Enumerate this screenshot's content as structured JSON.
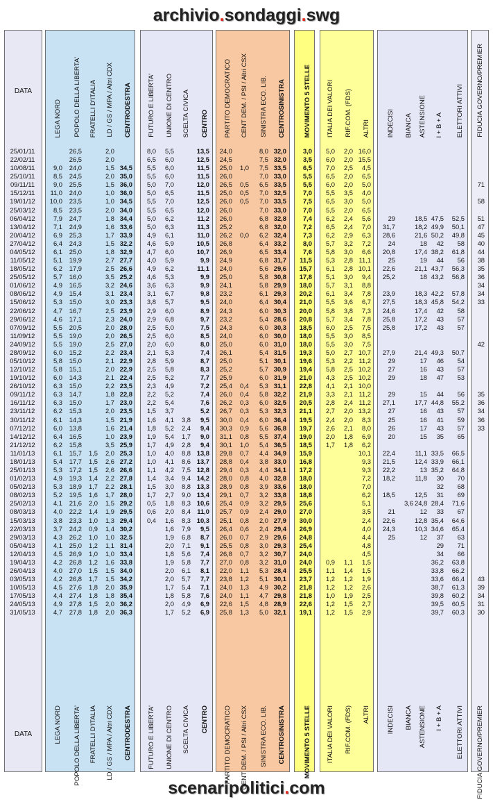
{
  "header_title": {
    "part1": "archivio",
    "dot1": ".",
    "part2": "sondaggi",
    "dot2": ".",
    "part3": "swg"
  },
  "footer_title": {
    "part1": "scenaripolitici",
    "dot": ".",
    "part2": "com"
  },
  "colors": {
    "data_band": "#e8e8f4",
    "centrodestra_band": "#c9e2f3",
    "centro_band": "#e6e7f6",
    "centrosinistra_band": "#f8c8a2",
    "m5s_band": "#ffff80",
    "idv_band": "#ffff9a",
    "astensione_band": "#e6e7f6",
    "fiducia_band": "#ecedf6",
    "accent": "#e0261b"
  },
  "groups": [
    {
      "id": "data",
      "band": "data_band",
      "columns": [
        "DATA"
      ],
      "horizontal": true
    },
    {
      "id": "cdx",
      "band": "centrodestra_band",
      "columns": [
        "LEGA NORD",
        "POPOLO DELLA LIBERTA'",
        "FRATELLI D'ITALIA",
        "LD / GS / MPA / Altri CDX",
        "CENTRODESTRA"
      ]
    },
    {
      "id": "ctr",
      "band": "centro_band",
      "columns": [
        "FUTURO E LIBERTA'",
        "UNIONE DI CENTRO",
        "SCELTA CIVICA",
        "CENTRO"
      ]
    },
    {
      "id": "csx",
      "band": "centrosinistra_band",
      "columns": [
        "PARTITO DEMOCRATICO",
        "CENT DEM. / PSI / Altri CSX",
        "SINISTRA ECO. LIB.",
        "CENTROSINISTRA"
      ]
    },
    {
      "id": "m5s",
      "band": "m5s_band",
      "columns": [
        "MOVIMENTO 5 STELLE"
      ]
    },
    {
      "id": "oth",
      "band": "idv_band",
      "columns": [
        "ITALIA DEI VALORI",
        "RIF.COM. (FDS)",
        "ALTRI"
      ]
    },
    {
      "id": "ast",
      "band": "astensione_band",
      "columns": [
        "INDECISI",
        "BIANCA",
        "ASTENSIONE",
        "I + B + A",
        "ELETTORI ATTIVI"
      ]
    },
    {
      "id": "fid",
      "band": "fiducia_band",
      "columns": [
        "FIDUCIA GOVERNO/PREMIER"
      ]
    }
  ],
  "rows": [
    [
      "25/01/11",
      "",
      "26,5",
      "",
      "2,0",
      "",
      "8,0",
      "5,5",
      "",
      "13,5",
      "24,0",
      "",
      "8,0",
      "32,0",
      "3,0",
      "5,0",
      "2,0",
      "16,0",
      "",
      "",
      "",
      "",
      "",
      ""
    ],
    [
      "22/02/11",
      "",
      "26,5",
      "",
      "2,0",
      "",
      "6,5",
      "6,0",
      "",
      "12,5",
      "24,5",
      "",
      "7,5",
      "32,0",
      "3,5",
      "6,0",
      "2,0",
      "15,5",
      "",
      "",
      "",
      "",
      "",
      ""
    ],
    [
      "10/08/11",
      "9,0",
      "24,0",
      "",
      "1,5",
      "34,5",
      "5,5",
      "6,0",
      "",
      "11,5",
      "25,0",
      "1,0",
      "7,5",
      "33,5",
      "6,5",
      "7,0",
      "2,5",
      "4,5",
      "",
      "",
      "",
      "",
      "",
      ""
    ],
    [
      "25/10/11",
      "8,5",
      "24,5",
      "",
      "2,0",
      "35,0",
      "5,5",
      "6,0",
      "",
      "11,5",
      "26,0",
      "",
      "7,0",
      "33,0",
      "5,5",
      "6,5",
      "2,0",
      "6,5",
      "",
      "",
      "",
      "",
      "",
      ""
    ],
    [
      "09/11/11",
      "9,0",
      "25,5",
      "",
      "1,5",
      "36,0",
      "5,0",
      "7,0",
      "",
      "12,0",
      "26,5",
      "0,5",
      "6,5",
      "33,5",
      "5,5",
      "6,0",
      "2,0",
      "5,0",
      "",
      "",
      "",
      "",
      "",
      "71"
    ],
    [
      "15/12/11",
      "11,0",
      "24,0",
      "",
      "1,0",
      "36,0",
      "5,0",
      "6,5",
      "",
      "11,5",
      "25,0",
      "0,5",
      "7,0",
      "32,5",
      "7,0",
      "5,5",
      "3,5",
      "4,0",
      "",
      "",
      "",
      "",
      "",
      ""
    ],
    [
      "19/01/12",
      "10,0",
      "23,5",
      "",
      "1,0",
      "34,5",
      "5,5",
      "7,0",
      "",
      "12,5",
      "26,0",
      "0,5",
      "7,0",
      "33,5",
      "7,5",
      "6,5",
      "3,0",
      "5,0",
      "",
      "",
      "",
      "",
      "",
      "58"
    ],
    [
      "25/03/12",
      "8,5",
      "23,5",
      "",
      "2,0",
      "34,0",
      "5,5",
      "6,5",
      "",
      "12,0",
      "26,0",
      "",
      "7,0",
      "33,0",
      "7,0",
      "5,5",
      "2,0",
      "6,5",
      "",
      "",
      "",
      "",
      "",
      ""
    ],
    [
      "06/04/12",
      "7,9",
      "24,7",
      "",
      "1,8",
      "34,4",
      "5,0",
      "6,2",
      "",
      "11,2",
      "26,0",
      "",
      "6,8",
      "32,8",
      "7,4",
      "6,2",
      "2,4",
      "5,6",
      "29",
      "",
      "18,5",
      "47,5",
      "52,5",
      "51"
    ],
    [
      "13/04/12",
      "7,1",
      "24,9",
      "",
      "1,6",
      "33,6",
      "5,0",
      "6,3",
      "",
      "11,3",
      "25,2",
      "",
      "6,8",
      "32,0",
      "7,2",
      "6,5",
      "2,4",
      "7,0",
      "31,7",
      "",
      "18,2",
      "49,9",
      "50,1",
      "47"
    ],
    [
      "20/04/12",
      "6,9",
      "25,3",
      "",
      "1,7",
      "33,9",
      "4,9",
      "6,1",
      "",
      "11,0",
      "26,2",
      "0,0",
      "6,2",
      "32,4",
      "7,3",
      "6,2",
      "2,9",
      "6,3",
      "28,6",
      "",
      "21,6",
      "50,2",
      "49,8",
      "45"
    ],
    [
      "27/04/12",
      "6,4",
      "24,3",
      "",
      "1,5",
      "32,2",
      "4,6",
      "5,9",
      "",
      "10,5",
      "26,8",
      "",
      "6,4",
      "33,2",
      "8,0",
      "5,7",
      "3,2",
      "7,2",
      "24",
      "",
      "18",
      "42",
      "58",
      "40"
    ],
    [
      "04/05/12",
      "6,1",
      "25,0",
      "",
      "1,8",
      "32,9",
      "4,7",
      "6,0",
      "",
      "10,7",
      "26,9",
      "",
      "6,5",
      "33,4",
      "7,6",
      "5,8",
      "3,0",
      "6,6",
      "20,8",
      "",
      "17,4",
      "38,2",
      "61,8",
      "44"
    ],
    [
      "11/05/12",
      "5,1",
      "19,9",
      "",
      "2,7",
      "27,7",
      "4,0",
      "5,9",
      "",
      "9,9",
      "24,9",
      "",
      "6,8",
      "31,7",
      "11,5",
      "5,3",
      "2,8",
      "11,1",
      "25",
      "",
      "19",
      "44",
      "56",
      "38"
    ],
    [
      "18/05/12",
      "6,2",
      "17,9",
      "",
      "2,5",
      "26,6",
      "4,9",
      "6,2",
      "",
      "11,1",
      "24,0",
      "",
      "5,6",
      "29,6",
      "15,7",
      "6,1",
      "2,8",
      "10,1",
      "22,6",
      "",
      "21,1",
      "43,7",
      "56,3",
      "35"
    ],
    [
      "25/05/12",
      "5,7",
      "16,0",
      "",
      "3,5",
      "25,2",
      "4,6",
      "5,3",
      "",
      "9,9",
      "25,0",
      "",
      "5,8",
      "30,8",
      "17,8",
      "5,1",
      "3,0",
      "9,4",
      "25,2",
      "",
      "18",
      "43,2",
      "56,8",
      "36"
    ],
    [
      "01/06/12",
      "4,9",
      "16,5",
      "",
      "3,2",
      "24,6",
      "3,6",
      "6,3",
      "",
      "9,9",
      "24,1",
      "",
      "5,8",
      "29,9",
      "18,0",
      "5,7",
      "3,1",
      "8,8",
      "",
      "",
      "",
      "",
      "",
      "34"
    ],
    [
      "08/06/12",
      "4,9",
      "15,4",
      "",
      "3,1",
      "23,4",
      "3,1",
      "6,7",
      "",
      "9,8",
      "23,2",
      "",
      "6,1",
      "29,3",
      "20,2",
      "6,1",
      "3,4",
      "7,8",
      "23,9",
      "",
      "18,3",
      "42,2",
      "57,8",
      "34"
    ],
    [
      "15/06/12",
      "5,3",
      "15,0",
      "",
      "3,0",
      "23,3",
      "3,8",
      "5,7",
      "",
      "9,5",
      "24,0",
      "",
      "6,4",
      "30,4",
      "21,0",
      "5,5",
      "3,6",
      "6,7",
      "27,5",
      "",
      "18,3",
      "45,8",
      "54,2",
      "33"
    ],
    [
      "22/06/12",
      "4,7",
      "16,7",
      "",
      "2,5",
      "23,9",
      "2,9",
      "6,0",
      "",
      "8,9",
      "24,3",
      "",
      "6,0",
      "30,3",
      "20,0",
      "5,8",
      "3,8",
      "7,3",
      "24,6",
      "",
      "17,4",
      "42",
      "58",
      ""
    ],
    [
      "29/06/12",
      "4,6",
      "17,1",
      "",
      "2,3",
      "24,0",
      "2,9",
      "6,8",
      "",
      "9,7",
      "23,2",
      "",
      "5,4",
      "28,6",
      "20,8",
      "5,7",
      "3,4",
      "7,8",
      "25,8",
      "",
      "17,2",
      "43",
      "57",
      ""
    ],
    [
      "07/09/12",
      "5,5",
      "20,5",
      "",
      "2,0",
      "28,0",
      "2,5",
      "5,0",
      "",
      "7,5",
      "24,3",
      "",
      "6,0",
      "30,3",
      "18,5",
      "6,0",
      "2,5",
      "7,5",
      "25,8",
      "",
      "17,2",
      "43",
      "57",
      ""
    ],
    [
      "11/09/12",
      "5,5",
      "19,0",
      "",
      "2,0",
      "26,5",
      "2,5",
      "6,0",
      "",
      "8,5",
      "24,0",
      "",
      "6,0",
      "30,0",
      "18,0",
      "5,5",
      "3,0",
      "8,5",
      "",
      "",
      "",
      "",
      "",
      ""
    ],
    [
      "24/09/12",
      "5,5",
      "19,0",
      "",
      "2,5",
      "27,0",
      "2,0",
      "6,0",
      "",
      "8,0",
      "25,0",
      "",
      "6,0",
      "31,0",
      "18,0",
      "5,5",
      "3,0",
      "7,5",
      "",
      "",
      "",
      "",
      "",
      "42"
    ],
    [
      "28/09/12",
      "6,0",
      "15,2",
      "",
      "2,2",
      "23,4",
      "2,1",
      "5,3",
      "",
      "7,4",
      "26,1",
      "",
      "5,4",
      "31,5",
      "19,3",
      "5,0",
      "2,7",
      "10,7",
      "27,9",
      "",
      "21,4",
      "49,3",
      "50,7",
      ""
    ],
    [
      "05/10/12",
      "5,8",
      "15,0",
      "",
      "2,1",
      "22,9",
      "2,8",
      "5,9",
      "",
      "8,7",
      "25,0",
      "",
      "5,1",
      "30,1",
      "19,6",
      "5,3",
      "2,2",
      "11,2",
      "29",
      "",
      "17",
      "46",
      "54",
      ""
    ],
    [
      "12/10/12",
      "5,8",
      "15,1",
      "",
      "2,0",
      "22,9",
      "2,5",
      "5,8",
      "",
      "8,3",
      "25,2",
      "",
      "5,7",
      "30,9",
      "19,4",
      "5,8",
      "2,5",
      "10,2",
      "27",
      "",
      "16",
      "43",
      "57",
      ""
    ],
    [
      "19/10/12",
      "6,0",
      "14,3",
      "",
      "2,1",
      "22,4",
      "2,5",
      "5,2",
      "",
      "7,7",
      "25,9",
      "",
      "6,0",
      "31,9",
      "21,0",
      "4,3",
      "2,5",
      "10,2",
      "29",
      "",
      "18",
      "47",
      "53",
      ""
    ],
    [
      "26/10/12",
      "6,3",
      "15,0",
      "",
      "2,2",
      "23,5",
      "2,3",
      "4,9",
      "",
      "7,2",
      "25,4",
      "0,4",
      "5,3",
      "31,1",
      "22,8",
      "4,1",
      "2,1",
      "10,0",
      "",
      "",
      "",
      "",
      "",
      ""
    ],
    [
      "09/11/12",
      "6,3",
      "14,7",
      "",
      "1,8",
      "22,8",
      "2,2",
      "5,2",
      "",
      "7,4",
      "26,0",
      "0,4",
      "5,8",
      "32,2",
      "21,9",
      "3,3",
      "2,1",
      "11,2",
      "29",
      "",
      "15",
      "44",
      "56",
      "35"
    ],
    [
      "16/11/12",
      "6,3",
      "15,0",
      "",
      "1,7",
      "23,0",
      "2,2",
      "5,4",
      "",
      "7,6",
      "26,2",
      "0,3",
      "6,0",
      "32,5",
      "20,5",
      "2,8",
      "2,4",
      "11,2",
      "27,1",
      "",
      "17,7",
      "44,8",
      "55,2",
      "36"
    ],
    [
      "23/11/12",
      "6,2",
      "15,3",
      "",
      "2,0",
      "23,5",
      "1,5",
      "3,7",
      "",
      "5,2",
      "26,7",
      "0,3",
      "5,3",
      "32,3",
      "21,1",
      "2,7",
      "2,0",
      "13,2",
      "27",
      "",
      "16",
      "43",
      "57",
      "34"
    ],
    [
      "30/11/12",
      "6,1",
      "14,3",
      "",
      "1,5",
      "21,9",
      "1,6",
      "4,1",
      "3,8",
      "9,5",
      "30,0",
      "0,4",
      "6,0",
      "36,4",
      "19,5",
      "2,4",
      "2,0",
      "8,3",
      "25",
      "",
      "16",
      "41",
      "59",
      "36"
    ],
    [
      "07/12/12",
      "6,0",
      "13,8",
      "",
      "1,6",
      "21,4",
      "1,8",
      "5,2",
      "2,4",
      "9,4",
      "30,3",
      "0,9",
      "5,6",
      "36,8",
      "19,7",
      "2,6",
      "2,1",
      "8,0",
      "26",
      "",
      "17",
      "43",
      "57",
      "33"
    ],
    [
      "14/12/12",
      "6,4",
      "16,5",
      "",
      "1,0",
      "23,9",
      "1,9",
      "5,4",
      "1,7",
      "9,0",
      "31,1",
      "0,8",
      "5,5",
      "37,4",
      "19,0",
      "2,0",
      "1,8",
      "6,9",
      "20",
      "",
      "15",
      "35",
      "65",
      ""
    ],
    [
      "21/12/12",
      "6,2",
      "15,8",
      "",
      "3,5",
      "25,9",
      "1,7",
      "4,9",
      "2,8",
      "9,4",
      "30,1",
      "1,0",
      "5,4",
      "36,5",
      "18,5",
      "1,7",
      "1,8",
      "6,2",
      "",
      "",
      "",
      "",
      "",
      ""
    ],
    [
      "11/01/13",
      "6,1",
      "15,7",
      "1,5",
      "2,0",
      "25,3",
      "1,0",
      "4,0",
      "8,8",
      "13,8",
      "29,8",
      "0,7",
      "4,4",
      "34,9",
      "15,9",
      "",
      "",
      "10,1",
      "22,4",
      "",
      "11,1",
      "33,5",
      "66,5",
      ""
    ],
    [
      "18/01/13",
      "5,4",
      "17,7",
      "1,5",
      "2,6",
      "27,2",
      "1,0",
      "4,1",
      "8,6",
      "13,7",
      "28,8",
      "0,4",
      "3,8",
      "33,0",
      "16,8",
      "",
      "",
      "9,3",
      "21,5",
      "",
      "12,4",
      "33,9",
      "66,1",
      ""
    ],
    [
      "25/01/13",
      "5,3",
      "17,2",
      "1,5",
      "2,6",
      "26,6",
      "1,1",
      "4,2",
      "7,5",
      "12,8",
      "29,4",
      "0,3",
      "4,4",
      "34,1",
      "17,2",
      "",
      "",
      "9,3",
      "22,2",
      "",
      "13",
      "35,2",
      "64,8",
      ""
    ],
    [
      "01/02/13",
      "4,9",
      "19,3",
      "1,4",
      "2,2",
      "27,8",
      "1,4",
      "3,4",
      "9,4",
      "14,2",
      "28,0",
      "0,8",
      "4,0",
      "32,8",
      "18,0",
      "",
      "",
      "7,2",
      "18,2",
      "",
      "11,8",
      "30",
      "70",
      ""
    ],
    [
      "05/02/13",
      "5,3",
      "18,9",
      "1,7",
      "2,2",
      "28,1",
      "1,5",
      "3,0",
      "8,8",
      "13,3",
      "28,9",
      "0,8",
      "3,9",
      "33,6",
      "18,0",
      "",
      "",
      "7,0",
      "",
      "",
      "",
      "32",
      "68",
      ""
    ],
    [
      "08/02/13",
      "5,2",
      "19,5",
      "1,6",
      "1,7",
      "28,0",
      "1,7",
      "2,7",
      "9,0",
      "13,4",
      "29,1",
      "0,7",
      "3,2",
      "33,8",
      "18,8",
      "",
      "",
      "6,2",
      "18,5",
      "",
      "12,5",
      "31",
      "69",
      ""
    ],
    [
      "25/02/13",
      "4,1",
      "21,6",
      "2,0",
      "1,5",
      "29,2",
      "0,5",
      "1,8",
      "8,3",
      "10,6",
      "25,4",
      "0,9",
      "3,2",
      "29,5",
      "25,6",
      "",
      "",
      "5,1",
      "",
      "3,6",
      "24,8",
      "28,4",
      "71,6",
      ""
    ],
    [
      "08/03/13",
      "4,0",
      "22,2",
      "1,4",
      "1,9",
      "29,5",
      "0,6",
      "2,0",
      "8,4",
      "11,0",
      "25,7",
      "0,9",
      "2,4",
      "29,0",
      "27,0",
      "",
      "",
      "3,5",
      "21",
      "",
      "12",
      "33",
      "67",
      ""
    ],
    [
      "15/03/13",
      "3,8",
      "23,3",
      "1,0",
      "1,3",
      "29,4",
      "0,4",
      "1,6",
      "8,3",
      "10,3",
      "25,1",
      "0,8",
      "2,0",
      "27,9",
      "30,0",
      "",
      "",
      "2,4",
      "22,6",
      "",
      "12,8",
      "35,4",
      "64,6",
      ""
    ],
    [
      "22/03/13",
      "3,7",
      "24,2",
      "0,9",
      "1,4",
      "30,2",
      "",
      "1,6",
      "7,9",
      "9,5",
      "26,4",
      "0,6",
      "2,4",
      "29,4",
      "26,9",
      "",
      "",
      "4,0",
      "24,3",
      "",
      "10,3",
      "34,6",
      "65,4",
      ""
    ],
    [
      "29/03/13",
      "4,3",
      "26,2",
      "1,0",
      "1,0",
      "32,5",
      "",
      "1,9",
      "6,8",
      "8,7",
      "26,0",
      "0,7",
      "2,9",
      "29,6",
      "24,8",
      "",
      "",
      "4,4",
      "25",
      "",
      "12",
      "37",
      "63",
      ""
    ],
    [
      "05/04/13",
      "4,1",
      "25,0",
      "1,2",
      "1,1",
      "31,4",
      "",
      "2,0",
      "7,1",
      "9,1",
      "25,5",
      "0,8",
      "3,0",
      "29,3",
      "25,4",
      "",
      "",
      "4,8",
      "",
      "",
      "",
      "29",
      "71",
      ""
    ],
    [
      "12/04/13",
      "4,5",
      "26,9",
      "1,0",
      "1,0",
      "33,4",
      "",
      "1,8",
      "5,6",
      "7,4",
      "26,8",
      "0,7",
      "3,2",
      "30,7",
      "24,0",
      "",
      "",
      "4,5",
      "",
      "",
      "",
      "34",
      "66",
      ""
    ],
    [
      "19/04/13",
      "4,2",
      "26,8",
      "1,2",
      "1,6",
      "33,8",
      "",
      "1,9",
      "5,8",
      "7,7",
      "27,0",
      "0,8",
      "3,2",
      "31,0",
      "24,0",
      "0,9",
      "1,1",
      "1,5",
      "",
      "",
      "",
      "36,2",
      "63,8",
      ""
    ],
    [
      "26/04/13",
      "4,0",
      "27,0",
      "1,5",
      "1,5",
      "34,0",
      "",
      "2,0",
      "6,1",
      "8,1",
      "22,0",
      "1,1",
      "5,3",
      "28,4",
      "25,5",
      "1,1",
      "1,4",
      "1,5",
      "",
      "",
      "",
      "33,8",
      "66,2",
      ""
    ],
    [
      "03/05/13",
      "4,2",
      "26,8",
      "1,7",
      "1,5",
      "34,2",
      "",
      "2,0",
      "5,7",
      "7,7",
      "23,8",
      "1,2",
      "5,1",
      "30,1",
      "23,7",
      "1,2",
      "1,2",
      "1,9",
      "",
      "",
      "",
      "33,6",
      "66,4",
      "43"
    ],
    [
      "10/05/13",
      "4,5",
      "27,6",
      "1,8",
      "2,0",
      "35,9",
      "",
      "1,7",
      "5,4",
      "7,1",
      "24,0",
      "1,3",
      "4,9",
      "30,2",
      "21,8",
      "1,2",
      "1,2",
      "2,6",
      "",
      "",
      "",
      "38,7",
      "61,3",
      "39"
    ],
    [
      "17/05/13",
      "4,4",
      "27,4",
      "1,8",
      "1,8",
      "35,4",
      "",
      "1,8",
      "5,8",
      "7,6",
      "24,0",
      "1,1",
      "4,7",
      "29,8",
      "21,8",
      "1,0",
      "1,9",
      "2,5",
      "",
      "",
      "",
      "39,8",
      "60,2",
      "34"
    ],
    [
      "24/05/13",
      "4,9",
      "27,8",
      "1,5",
      "2,0",
      "36,2",
      "",
      "2,0",
      "4,9",
      "6,9",
      "22,6",
      "1,5",
      "4,8",
      "28,9",
      "22,6",
      "1,2",
      "1,5",
      "2,7",
      "",
      "",
      "",
      "39,5",
      "60,5",
      "31"
    ],
    [
      "31/05/13",
      "4,7",
      "27,8",
      "1,8",
      "2,0",
      "36,3",
      "",
      "1,7",
      "5,2",
      "6,9",
      "25,8",
      "1,3",
      "5,0",
      "32,1",
      "19,1",
      "1,2",
      "1,5",
      "2,9",
      "",
      "",
      "",
      "39,7",
      "60,3",
      "30"
    ]
  ]
}
